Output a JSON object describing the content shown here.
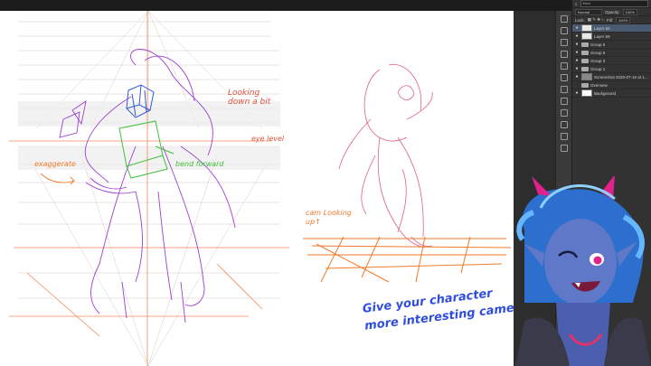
{
  "notes": {
    "looking_down": "Looking down a bit",
    "eye_level": "eye level",
    "exaggerate": "exaggerate",
    "bend_forward": "bend forward",
    "cam_looking_up": "cam Looking up↑"
  },
  "caption": {
    "line1": "Give your character",
    "line2": "more interesting camera angle"
  },
  "layers_panel": {
    "search_label": "Kind",
    "blend_mode": "Normal",
    "opacity_label": "Opacity:",
    "opacity_value": "100%",
    "lock_label": "Lock:",
    "fill_label": "Fill:",
    "fill_value": "100%",
    "layers": [
      {
        "name": "Layer 60",
        "type": "pixel",
        "selected": true
      },
      {
        "name": "Layer 59",
        "type": "pixel",
        "selected": false
      },
      {
        "name": "Group 6",
        "type": "group",
        "selected": false
      },
      {
        "name": "Group 5",
        "type": "group",
        "selected": false
      },
      {
        "name": "Group 3",
        "type": "group",
        "selected": false
      },
      {
        "name": "Group 1",
        "type": "group",
        "selected": false
      },
      {
        "name": "Screenshot 2020-07-18 at 14.38",
        "type": "pixel",
        "selected": false
      },
      {
        "name": "Overview",
        "type": "group",
        "selected": false
      },
      {
        "name": "Background",
        "type": "background",
        "selected": false
      }
    ]
  },
  "icons": {
    "eye": "eye-icon",
    "folder": "folder-icon",
    "search": "search-icon"
  },
  "colors": {
    "note_red": "#e0523c",
    "note_orange": "#f07a2a",
    "note_green": "#3fbf3a",
    "caption_blue": "#2f4dde",
    "sketch_purple": "#9b3fd0",
    "sketch_pink": "#e0607a"
  }
}
